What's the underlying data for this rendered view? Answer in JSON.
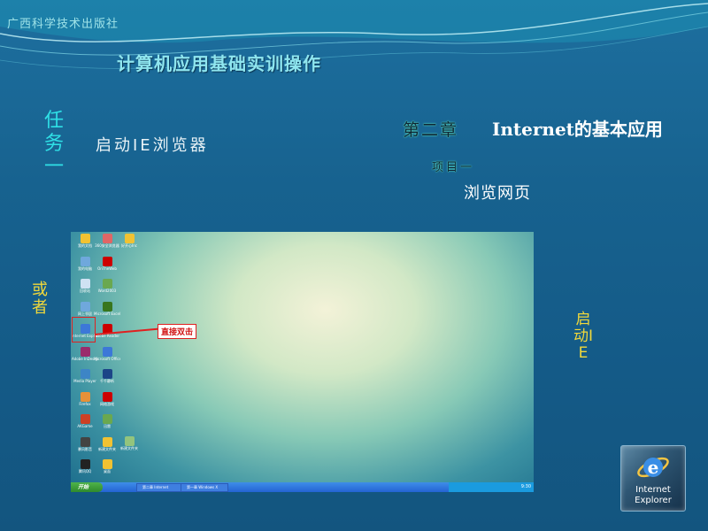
{
  "header": {
    "publisher": "广西科学技术出版社",
    "course_title": "计算机应用基础实训操作"
  },
  "task": {
    "label_vertical": "任务一",
    "text": "启动IE浏览器"
  },
  "chapter": {
    "number": "第二章",
    "title": "Internet的基本应用",
    "project": "项目一",
    "subtitle": "浏览网页"
  },
  "side_notes": {
    "or": "或者",
    "start_ie": "启动IE"
  },
  "desktop": {
    "icons": [
      {
        "label": "我的文档",
        "icon": "folder-icon",
        "color": "#f1c232"
      },
      {
        "label": "我的电脑",
        "icon": "computer-icon",
        "color": "#6fa8dc"
      },
      {
        "label": "回收站",
        "icon": "recycle-bin-icon",
        "color": "#cfe2f3"
      },
      {
        "label": "网上邻居",
        "icon": "network-icon",
        "color": "#6fa8dc"
      },
      {
        "label": "Internet Explorer",
        "icon": "ie-icon",
        "color": "#3c78d8"
      },
      {
        "label": "Adobe InDesign CS",
        "icon": "indesign-icon",
        "color": "#9a2b6c"
      },
      {
        "label": "Media Player",
        "icon": "media-player-icon",
        "color": "#3d85c6"
      },
      {
        "label": "Firefox",
        "icon": "firefox-icon",
        "color": "#e69138"
      },
      {
        "label": "AKGame",
        "icon": "game-icon",
        "color": "#cc4125"
      },
      {
        "label": "暴风影音",
        "icon": "player-icon",
        "color": "#434343"
      },
      {
        "label": "腾讯QQ",
        "icon": "qq-icon",
        "color": "#222222"
      }
    ],
    "icons_col2": [
      {
        "label": "360安全浏览器",
        "icon": "browser-icon",
        "color": "#e06666"
      },
      {
        "label": "OnTheWeb",
        "icon": "web-icon",
        "color": "#cc0000"
      },
      {
        "label": "Word2003",
        "icon": "word-icon",
        "color": "#6aa84f"
      },
      {
        "label": "Microsoft Excel",
        "icon": "excel-icon",
        "color": "#38761d"
      },
      {
        "label": "Adobe Reader",
        "icon": "reader-icon",
        "color": "#cc0000"
      },
      {
        "label": "Microsoft Office",
        "icon": "office-icon",
        "color": "#3c78d8"
      },
      {
        "label": "千千静听",
        "icon": "music-icon",
        "color": "#1c4587"
      },
      {
        "label": "网络游戏",
        "icon": "game2-icon",
        "color": "#cc0000"
      },
      {
        "label": "迅雷",
        "icon": "download-icon",
        "color": "#6aa84f"
      },
      {
        "label": "新建文件夹",
        "icon": "folder2-icon",
        "color": "#f1c232"
      },
      {
        "label": "桌面",
        "icon": "folder3-icon",
        "color": "#f1c232"
      }
    ],
    "icons_col3": [
      {
        "label": "好开心Inc",
        "icon": "app-icon",
        "color": "#f1c232"
      },
      {
        "label": "新建文件夹",
        "icon": "folder4-icon",
        "color": "#93c47d"
      }
    ],
    "callout": "直接双击",
    "start_label": "开始",
    "taskbar_items": [
      "第二章 Internet",
      "第一章 Windows X"
    ],
    "clock": "9:30"
  },
  "ie_badge": {
    "line1": "Internet",
    "line2": "Explorer"
  }
}
